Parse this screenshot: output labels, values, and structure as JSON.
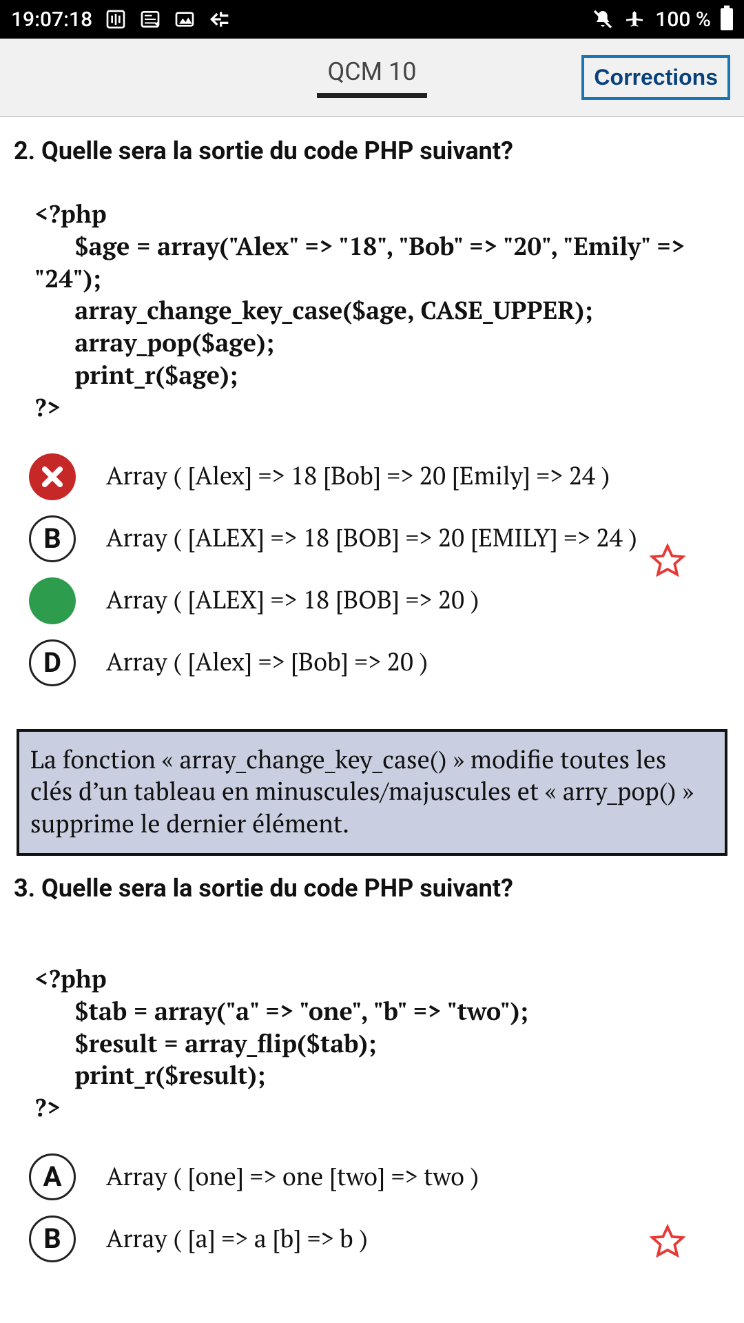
{
  "status": {
    "time": "19:07:18",
    "battery_text": "100 %"
  },
  "header": {
    "title": "QCM 10",
    "corrections": "Corrections"
  },
  "q2": {
    "title": "2. Quelle sera la sortie du code PHP suivant?",
    "code": "<?php\n      $age = array(\"Alex\" => \"18\", \"Bob\" => \"20\", \"Emily\" => \"24\");\n      array_change_key_case($age, CASE_UPPER);\n      array_pop($age);\n      print_r($age);\n?>",
    "answers": {
      "a": "Array ( [Alex] => 18    [Bob] => 20    [Emily] => 24 )",
      "b_letter": "B",
      "b": "Array ( [ALEX] => 18    [BOB] => 20    [EMILY] => 24 )",
      "c": "Array ( [ALEX] => 18    [BOB] => 20 )",
      "d_letter": "D",
      "d": "Array ( [Alex] =>     [Bob] => 20 )"
    },
    "explain": "La fonction « array_change_key_case() » modifie toutes les clés d’un tableau en minuscules/majuscules et « arry_pop() » supprime le dernier élément."
  },
  "q3": {
    "title": "3. Quelle sera la sortie du code PHP suivant?",
    "code": "<?php\n      $tab = array(\"a\" => \"one\", \"b\" => \"two\");\n      $result = array_flip($tab);\n      print_r($result);\n?>",
    "answers": {
      "a_letter": "A",
      "a": "Array ( [one] => one [two] => two )",
      "b_letter": "B",
      "b": "Array ( [a] => a [b] => b )"
    }
  }
}
